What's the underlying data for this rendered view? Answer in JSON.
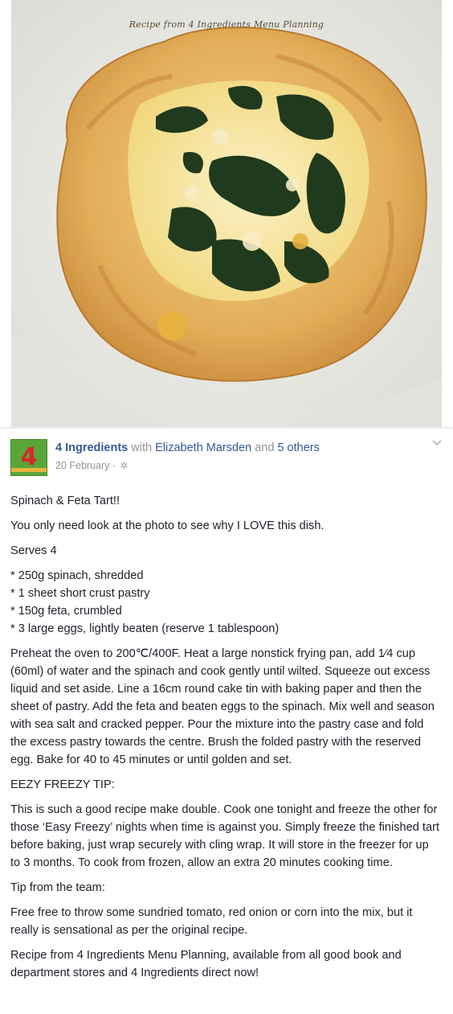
{
  "photo": {
    "watermark": "Recipe from 4 Ingredients Menu Planning",
    "alt": "Spinach and feta tart"
  },
  "post": {
    "page_name": "4 Ingredients",
    "with_word": "with",
    "tagged_person": "Elizabeth Marsden",
    "and_word": "and",
    "others": "5 others",
    "date": "20 February",
    "separator": "·",
    "avatar_text": "4",
    "title": "Spinach & Feta Tart!!",
    "intro": "You only need look at the photo to see why I LOVE this dish.",
    "serves": "Serves 4",
    "ingredients": [
      "* 250g spinach, shredded",
      "* 1 sheet short crust pastry",
      "* 150g feta, crumbled",
      "* 3 large eggs, lightly beaten (reserve 1 tablespoon)"
    ],
    "method": "Preheat the oven to 200℃/400F. Heat a large nonstick frying pan, add 1⁄4 cup (60ml) of water and the spinach and cook gently until wilted. Squeeze out excess liquid and set aside. Line a 16cm round cake tin with baking paper and then the sheet of pastry. Add the feta and beaten eggs to the spinach. Mix well and season with sea salt and cracked pepper. Pour the mixture into the pastry case and fold the excess pastry towards the centre. Brush the folded pastry with the reserved egg. Bake for 40 to 45 minutes or until golden and set.",
    "tip_heading": "EEZY FREEZY TIP:",
    "tip": "This is such a good recipe make double. Cook one tonight and freeze the other for those ‘Easy Freezy’ nights when time is against you. Simply freeze the finished tart before baking, just wrap securely with cling wrap. It will store in the freezer for up to 3 months. To cook from frozen, allow an extra 20 minutes cooking time.",
    "team_heading": "Tip from the team:",
    "team_tip": "Free free to throw some sundried tomato, red onion or corn into the mix, but it really is sensational as per the original recipe.",
    "closing": "Recipe from 4 Ingredients Menu Planning, available from all good book and department stores and 4 Ingredients direct now!"
  },
  "icons": {
    "audience": "globe-icon",
    "options": "chevron-down-icon"
  },
  "colors": {
    "link": "#365899",
    "muted": "#90949c",
    "text": "#1d2129",
    "avatar_bg": "#5aa53a",
    "avatar_number": "#d8262a"
  }
}
